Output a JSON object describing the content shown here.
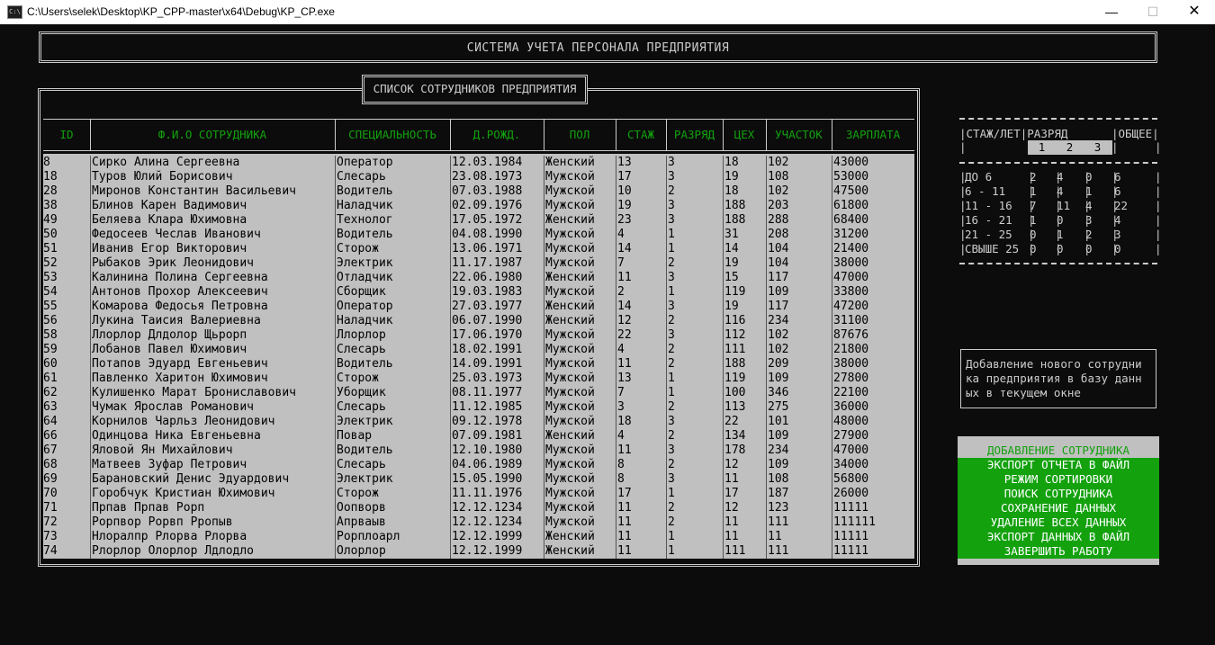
{
  "window": {
    "title": "C:\\Users\\selek\\Desktop\\KP_CPP-master\\x64\\Debug\\KP_CP.exe",
    "icon_text": "C:\\",
    "min": "—",
    "max": "☐",
    "close": "✕"
  },
  "header": {
    "title": "СИСТЕМА УЧЕТА ПЕРСОНАЛА ПРЕДПРИЯТИЯ"
  },
  "list": {
    "title": "СПИСОК СОТРУДНИКОВ ПРЕДПРИЯТИЯ",
    "columns": [
      "ID",
      "Ф.И.О СОТРУДНИКА",
      "СПЕЦИАЛЬНОСТЬ",
      "Д.РОЖД.",
      "ПОЛ",
      "СТАЖ",
      "РАЗРЯД",
      "ЦЕХ",
      "УЧАСТОК",
      "ЗАРПЛАТА"
    ],
    "rows": [
      [
        "8",
        "Сирко Алина Сергеевна",
        "Оператор",
        "12.03.1984",
        "Женский",
        "13",
        "3",
        "18",
        "102",
        "43000"
      ],
      [
        "18",
        "Туров Юлий Борисович",
        "Слесарь",
        "23.08.1973",
        "Мужской",
        "17",
        "3",
        "19",
        "108",
        "53000"
      ],
      [
        "28",
        "Миронов Константин Васильевич",
        "Водитель",
        "07.03.1988",
        "Мужской",
        "10",
        "2",
        "18",
        "102",
        "47500"
      ],
      [
        "38",
        "Блинов Карен Вадимович",
        "Наладчик",
        "02.09.1976",
        "Мужской",
        "19",
        "3",
        "188",
        "203",
        "61800"
      ],
      [
        "49",
        "Беляева Клара Юхимовна",
        "Технолог",
        "17.05.1972",
        "Женский",
        "23",
        "3",
        "188",
        "288",
        "68400"
      ],
      [
        "50",
        "Федосеев Чеслав Иванович",
        "Водитель",
        "04.08.1990",
        "Мужской",
        "4",
        "1",
        "31",
        "208",
        "31200"
      ],
      [
        "51",
        "Иванив Егор Викторович",
        "Сторож",
        "13.06.1971",
        "Мужской",
        "14",
        "1",
        "14",
        "104",
        "21400"
      ],
      [
        "52",
        "Рыбаков Эрик Леонидович",
        "Электрик",
        "11.17.1987",
        "Мужской",
        "7",
        "2",
        "19",
        "104",
        "38000"
      ],
      [
        "53",
        "Калинина Полина Сергеевна",
        "Отладчик",
        "22.06.1980",
        "Женский",
        "11",
        "3",
        "15",
        "117",
        "47000"
      ],
      [
        "54",
        "Антонов Прохор Алексеевич",
        "Сборщик",
        "19.03.1983",
        "Мужской",
        "2",
        "1",
        "119",
        "109",
        "33800"
      ],
      [
        "55",
        "Комарова Федосья Петровна",
        "Оператор",
        "27.03.1977",
        "Женский",
        "14",
        "3",
        "19",
        "117",
        "47200"
      ],
      [
        "56",
        "Лукина Таисия Валериевна",
        "Наладчик",
        "06.07.1990",
        "Женский",
        "12",
        "2",
        "116",
        "234",
        "31100"
      ],
      [
        "58",
        "Ллорлор Длдолор Щьрорп",
        "Ллорлор",
        "17.06.1970",
        "Мужской",
        "22",
        "3",
        "112",
        "102",
        "87676"
      ],
      [
        "59",
        "Лобанов Павел Юхимович",
        "Слесарь",
        "18.02.1991",
        "Мужской",
        "4",
        "2",
        "111",
        "102",
        "21800"
      ],
      [
        "60",
        "Потапов Эдуард Евгеньевич",
        "Водитель",
        "14.09.1991",
        "Мужской",
        "11",
        "2",
        "188",
        "209",
        "38000"
      ],
      [
        "61",
        "Павленко Харитон Юхимович",
        "Сторож",
        "25.03.1973",
        "Мужской",
        "13",
        "1",
        "119",
        "109",
        "27800"
      ],
      [
        "62",
        "Кулишенко Марат Брониславович",
        "Уборщик",
        "08.11.1977",
        "Мужской",
        "7",
        "1",
        "100",
        "346",
        "22100"
      ],
      [
        "63",
        "Чумак Ярослав Романович",
        "Слесарь",
        "11.12.1985",
        "Мужской",
        "3",
        "2",
        "113",
        "275",
        "36000"
      ],
      [
        "64",
        "Корнилов Чарльз Леонидович",
        "Электрик",
        "09.12.1978",
        "Мужской",
        "18",
        "3",
        "22",
        "101",
        "48000"
      ],
      [
        "66",
        "Одинцова Ника Евгеньевна",
        "Повар",
        "07.09.1981",
        "Женский",
        "4",
        "2",
        "134",
        "109",
        "27900"
      ],
      [
        "67",
        "Яловой Ян Михайлович",
        "Водитель",
        "12.10.1980",
        "Мужской",
        "11",
        "3",
        "178",
        "234",
        "47000"
      ],
      [
        "68",
        "Матвеев Зуфар Петрович",
        "Слесарь",
        "04.06.1989",
        "Мужской",
        "8",
        "2",
        "12",
        "109",
        "34000"
      ],
      [
        "69",
        "Барановский Денис Эдуардович",
        "Электрик",
        "15.05.1990",
        "Мужской",
        "8",
        "3",
        "11",
        "108",
        "56800"
      ],
      [
        "70",
        "Горобчук Кристиан Юхимович",
        "Сторож",
        "11.11.1976",
        "Мужской",
        "17",
        "1",
        "17",
        "187",
        "26000"
      ],
      [
        "71",
        "Прпав Прпав Рорп",
        "Оопворв",
        "12.12.1234",
        "Мужской",
        "11",
        "2",
        "12",
        "123",
        "11111"
      ],
      [
        "72",
        "Рорпвор Рорвп Рропыв",
        "Апрваыв",
        "12.12.1234",
        "Мужской",
        "11",
        "2",
        "11",
        "111",
        "111111"
      ],
      [
        "73",
        "Нлоралпр Рлорва Рлорва",
        "Рорплоарл",
        "12.12.1999",
        "Женский",
        "11",
        "1",
        "11",
        "11",
        "11111"
      ],
      [
        "74",
        "Рлорлор Олорлор Лдлодло",
        "Олорлор",
        "12.12.1999",
        "Женский",
        "11",
        "1",
        "111",
        "111",
        "11111"
      ]
    ]
  },
  "stats": {
    "header_col1": "СТАЖ/ЛЕТ",
    "header_col2": "РАЗРЯД",
    "header_col3": "ОБЩЕЕ",
    "grades": [
      "1",
      "2",
      "3"
    ],
    "rows": [
      [
        "ДО 6",
        "2",
        "4",
        "0",
        "6"
      ],
      [
        "6 - 11",
        "1",
        "4",
        "1",
        "6"
      ],
      [
        "11 - 16",
        "7",
        "11",
        "4",
        "22"
      ],
      [
        "16 - 21",
        "1",
        "0",
        "3",
        "4"
      ],
      [
        "21 - 25",
        "0",
        "1",
        "2",
        "3"
      ],
      [
        "СВЫШЕ 25",
        "0",
        "0",
        "0",
        "0"
      ]
    ]
  },
  "hint": {
    "lines": [
      "Добавление нового сотрудни",
      "ка предприятия в базу данн",
      "ых в текущем окне"
    ]
  },
  "menu": {
    "selected_index": 0,
    "items": [
      "ДОБАВЛЕНИЕ СОТРУДНИКА",
      "ЭКСПОРТ ОТЧЕТА В ФАЙЛ",
      "РЕЖИМ СОРТИРОВКИ",
      "ПОИСК СОТРУДНИКА",
      "СОХРАНЕНИЕ ДАННЫХ",
      "УДАЛЕНИЕ ВСЕХ ДАННЫХ",
      "ЭКСПОРТ ДАННЫХ В ФАЙЛ",
      "ЗАВЕРШИТЬ РАБОТУ"
    ]
  },
  "colors": {
    "background": "#0c0c0c",
    "text": "#cccccc",
    "accent_green": "#13a10e",
    "table_gray": "#c0c0c0"
  }
}
